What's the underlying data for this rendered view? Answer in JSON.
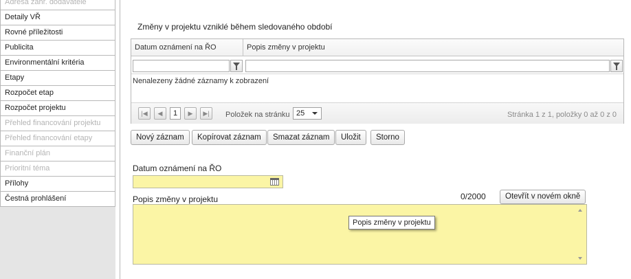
{
  "sidebar": {
    "items": [
      {
        "label": "Adresa zahr. dodavatele",
        "disabled": true
      },
      {
        "label": "Detaily VŘ",
        "disabled": false
      },
      {
        "label": "Rovné příležitosti",
        "disabled": false
      },
      {
        "label": "Publicita",
        "disabled": false
      },
      {
        "label": "Environmentální kritéria",
        "disabled": false
      },
      {
        "label": "Etapy",
        "disabled": false
      },
      {
        "label": "Rozpočet etap",
        "disabled": false
      },
      {
        "label": "Rozpočet projektu",
        "disabled": false
      },
      {
        "label": "Přehled financování projektu",
        "disabled": true
      },
      {
        "label": "Přehled financování etapy",
        "disabled": true
      },
      {
        "label": "Finanční plán",
        "disabled": true
      },
      {
        "label": "Prioritní téma",
        "disabled": true
      },
      {
        "label": "Přílohy",
        "disabled": false
      },
      {
        "label": "Čestná prohlášení",
        "disabled": false
      }
    ]
  },
  "main": {
    "section_title": "Změny v projektu vzniklé během sledovaného období",
    "grid": {
      "columns": [
        "Datum oznámení na ŘO",
        "Popis změny v projektu"
      ],
      "empty_message": "Nenalezeny žádné záznamy k zobrazení",
      "pager": {
        "first": "|◀",
        "prev": "◀",
        "current_page": "1",
        "next": "▶",
        "last": "▶|",
        "per_page_label": "Položek na stránku",
        "per_page_value": "25",
        "info": "Stránka 1 z 1, položky 0 až 0 z 0"
      }
    },
    "toolbar": {
      "new": "Nový záznam",
      "copy": "Kopírovat záznam",
      "delete": "Smazat záznam",
      "save": "Uložit",
      "cancel": "Storno"
    },
    "form": {
      "date_label": "Datum oznámení na ŘO",
      "date_value": "",
      "desc_label": "Popis změny v projektu",
      "counter": "0/2000",
      "open_window": "Otevřít v novém okně",
      "tooltip": "Popis změny v projektu"
    }
  },
  "colors": {
    "required_field": "#fbf5a5",
    "disabled_text": "#b4b4b4",
    "sidebar_bg": "#e5e5e5"
  }
}
